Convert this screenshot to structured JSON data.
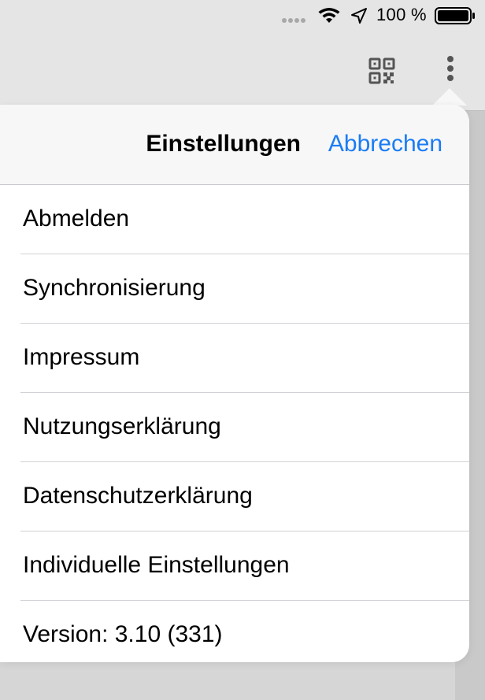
{
  "status_bar": {
    "battery_percent": "100 %",
    "icons": [
      "signal-dots-icon",
      "wifi-icon",
      "location-arrow-icon",
      "battery-icon"
    ]
  },
  "nav_bar": {
    "icons": [
      "qr-code-icon",
      "more-vertical-icon"
    ]
  },
  "settings_popover": {
    "title": "Einstellungen",
    "cancel_label": "Abbrechen",
    "items": [
      {
        "label": "Abmelden"
      },
      {
        "label": "Synchronisierung"
      },
      {
        "label": "Impressum"
      },
      {
        "label": "Nutzungserklärung"
      },
      {
        "label": "Datenschutzerklärung"
      },
      {
        "label": "Individuelle Einstellungen"
      },
      {
        "label": "Version: 3.10 (331)"
      }
    ]
  },
  "colors": {
    "accent": "#1a7cf5",
    "header_bg": "#f7f7f7",
    "backdrop": "#d3d3d3"
  }
}
